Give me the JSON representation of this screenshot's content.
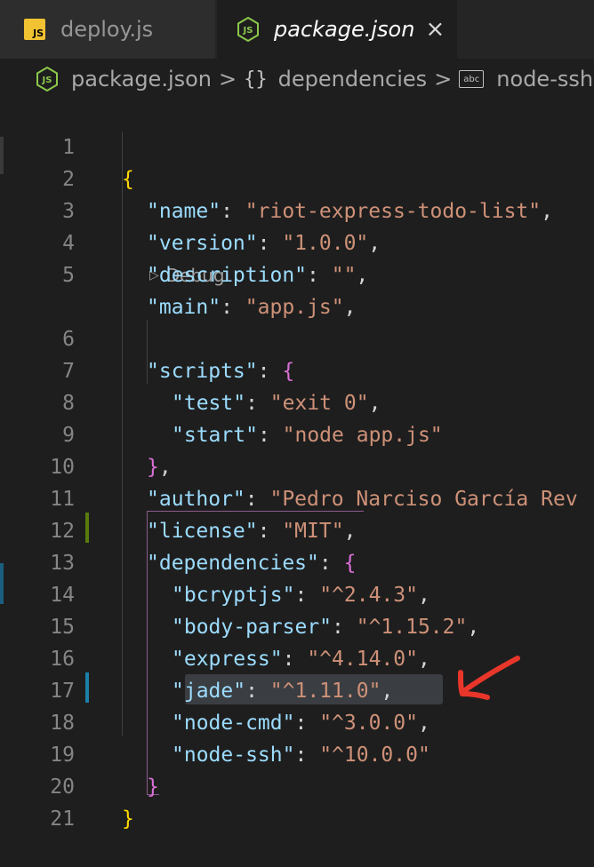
{
  "tabs": [
    {
      "label": "deploy.js",
      "icon": "js-file-icon",
      "badge": "JS",
      "active": false
    },
    {
      "label": "package.json",
      "icon": "nodejs-file-icon",
      "active": true,
      "close": "×"
    }
  ],
  "breadcrumb": {
    "file": "package.json",
    "separator": ">",
    "object_icon": "{}",
    "object": "dependencies",
    "string_icon": "abc",
    "property": "node-ssh"
  },
  "codelens": {
    "label": "Debug",
    "icon": "play-icon"
  },
  "lines": {
    "l1": {
      "n": "1",
      "brace": "{"
    },
    "l2": {
      "n": "2",
      "key": "\"name\"",
      "colon": ": ",
      "val": "\"riot-express-todo-list\"",
      "tail": ","
    },
    "l3": {
      "n": "3",
      "key": "\"version\"",
      "colon": ": ",
      "val": "\"1.0.0\"",
      "tail": ","
    },
    "l4": {
      "n": "4",
      "key": "\"description\"",
      "colon": ": ",
      "val": "\"\"",
      "tail": ","
    },
    "l5": {
      "n": "5",
      "key": "\"main\"",
      "colon": ": ",
      "val": "\"app.js\"",
      "tail": ","
    },
    "l6": {
      "n": "6",
      "key": "\"scripts\"",
      "colon": ": ",
      "brace": "{"
    },
    "l7": {
      "n": "7",
      "key": "\"test\"",
      "colon": ": ",
      "val": "\"exit 0\"",
      "tail": ","
    },
    "l8": {
      "n": "8",
      "key": "\"start\"",
      "colon": ": ",
      "val": "\"node app.js\""
    },
    "l9": {
      "n": "9",
      "brace": "}",
      "tail": ","
    },
    "l10": {
      "n": "10",
      "key": "\"author\"",
      "colon": ": ",
      "val": "\"Pedro Narciso García Rev"
    },
    "l11": {
      "n": "11",
      "key": "\"license\"",
      "colon": ": ",
      "val": "\"MIT\"",
      "tail": ","
    },
    "l12": {
      "n": "12",
      "key": "\"dependencies\"",
      "colon": ": ",
      "brace": "{"
    },
    "l13": {
      "n": "13",
      "key": "\"bcryptjs\"",
      "colon": ": ",
      "val": "\"^2.4.3\"",
      "tail": ","
    },
    "l14": {
      "n": "14",
      "key": "\"body-parser\"",
      "colon": ": ",
      "val": "\"^1.15.2\"",
      "tail": ","
    },
    "l15": {
      "n": "15",
      "key": "\"express\"",
      "colon": ": ",
      "val": "\"^4.14.0\"",
      "tail": ","
    },
    "l16": {
      "n": "16",
      "key": "\"jade\"",
      "colon": ": ",
      "val": "\"^1.11.0\"",
      "tail": ","
    },
    "l17": {
      "n": "17",
      "key": "\"node-cmd\"",
      "colon": ": ",
      "val": "\"^3.0.0\"",
      "tail": ","
    },
    "l18": {
      "n": "18",
      "key": "\"node-ssh\"",
      "colon": ": ",
      "val": "\"^10.0.0\""
    },
    "l19": {
      "n": "19",
      "brace": "}"
    },
    "l20": {
      "n": "20",
      "brace": "}"
    },
    "l21": {
      "n": "21"
    }
  },
  "colors": {
    "key": "#9cdcfe",
    "string": "#ce9178",
    "bracket_level1": "#ffd700",
    "bracket_level2": "#da70d6",
    "modified_marker": "#1b81a8",
    "added_marker": "#587c0c",
    "annotation_arrow": "#e8362a"
  },
  "annotation": {
    "icon": "red-arrow-icon"
  }
}
